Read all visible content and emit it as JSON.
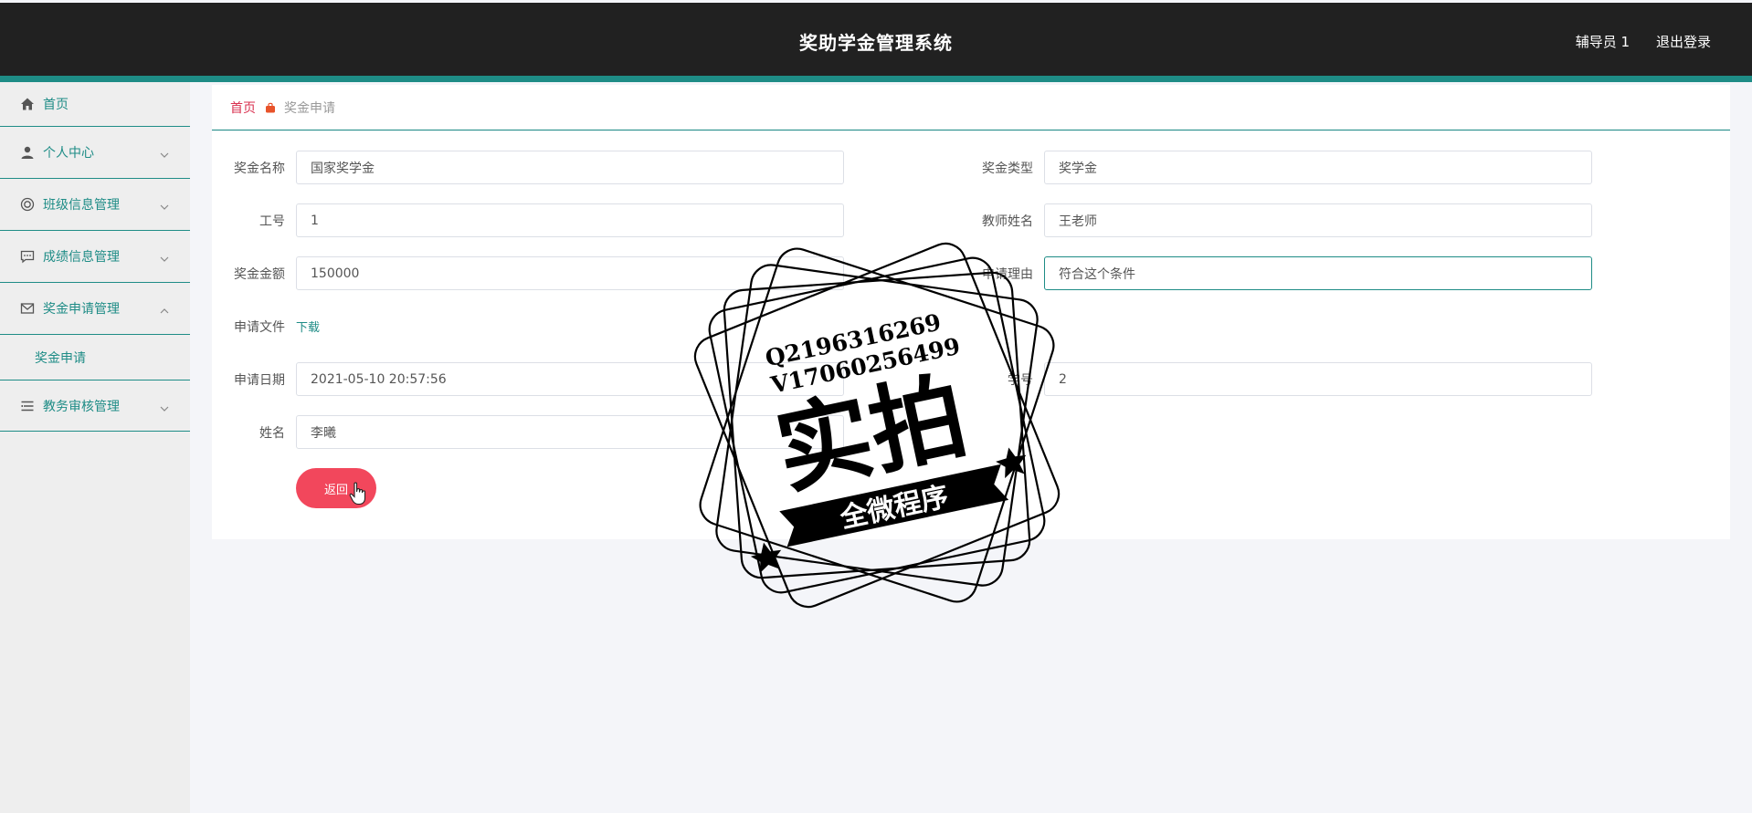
{
  "header": {
    "title": "奖助学金管理系统",
    "user": "辅导员 1",
    "logout": "退出登录"
  },
  "sidebar": {
    "items": [
      {
        "label": "首页",
        "icon": "home-icon"
      },
      {
        "label": "个人中心",
        "icon": "user-icon",
        "expandable": true
      },
      {
        "label": "班级信息管理",
        "icon": "target-icon",
        "expandable": true
      },
      {
        "label": "成绩信息管理",
        "icon": "chat-icon",
        "expandable": true
      },
      {
        "label": "奖金申请管理",
        "icon": "mail-icon",
        "expandable": true,
        "expanded": true
      },
      {
        "label": "教务审核管理",
        "icon": "list-icon",
        "expandable": true
      }
    ],
    "sub_items": [
      {
        "label": "奖金申请"
      }
    ]
  },
  "breadcrumb": {
    "home": "首页",
    "current": "奖金申请"
  },
  "form": {
    "fields": {
      "award_name": {
        "label": "奖金名称",
        "value": "国家奖学金"
      },
      "award_type": {
        "label": "奖金类型",
        "value": "奖学金"
      },
      "staff_no": {
        "label": "工号",
        "value": "1"
      },
      "teacher_name": {
        "label": "教师姓名",
        "value": "王老师"
      },
      "amount": {
        "label": "奖金金额",
        "value": "150000"
      },
      "reason": {
        "label": "申请理由",
        "value": "符合这个条件"
      },
      "file": {
        "label": "申请文件",
        "link": "下载"
      },
      "apply_date": {
        "label": "申请日期",
        "value": "2021-05-10 20:57:56"
      },
      "student_no": {
        "label": "学号",
        "value": "2"
      },
      "name": {
        "label": "姓名",
        "value": "李曦"
      }
    },
    "back_button": "返回"
  },
  "watermark": {
    "line1": "Q2196316269",
    "line2": "V17060256499",
    "big": "实拍",
    "banner": "全微程序"
  },
  "colors": {
    "accent": "#1e8c86",
    "header_bg": "#212121",
    "danger": "#f2475c",
    "crumb_home": "#d9304f"
  }
}
